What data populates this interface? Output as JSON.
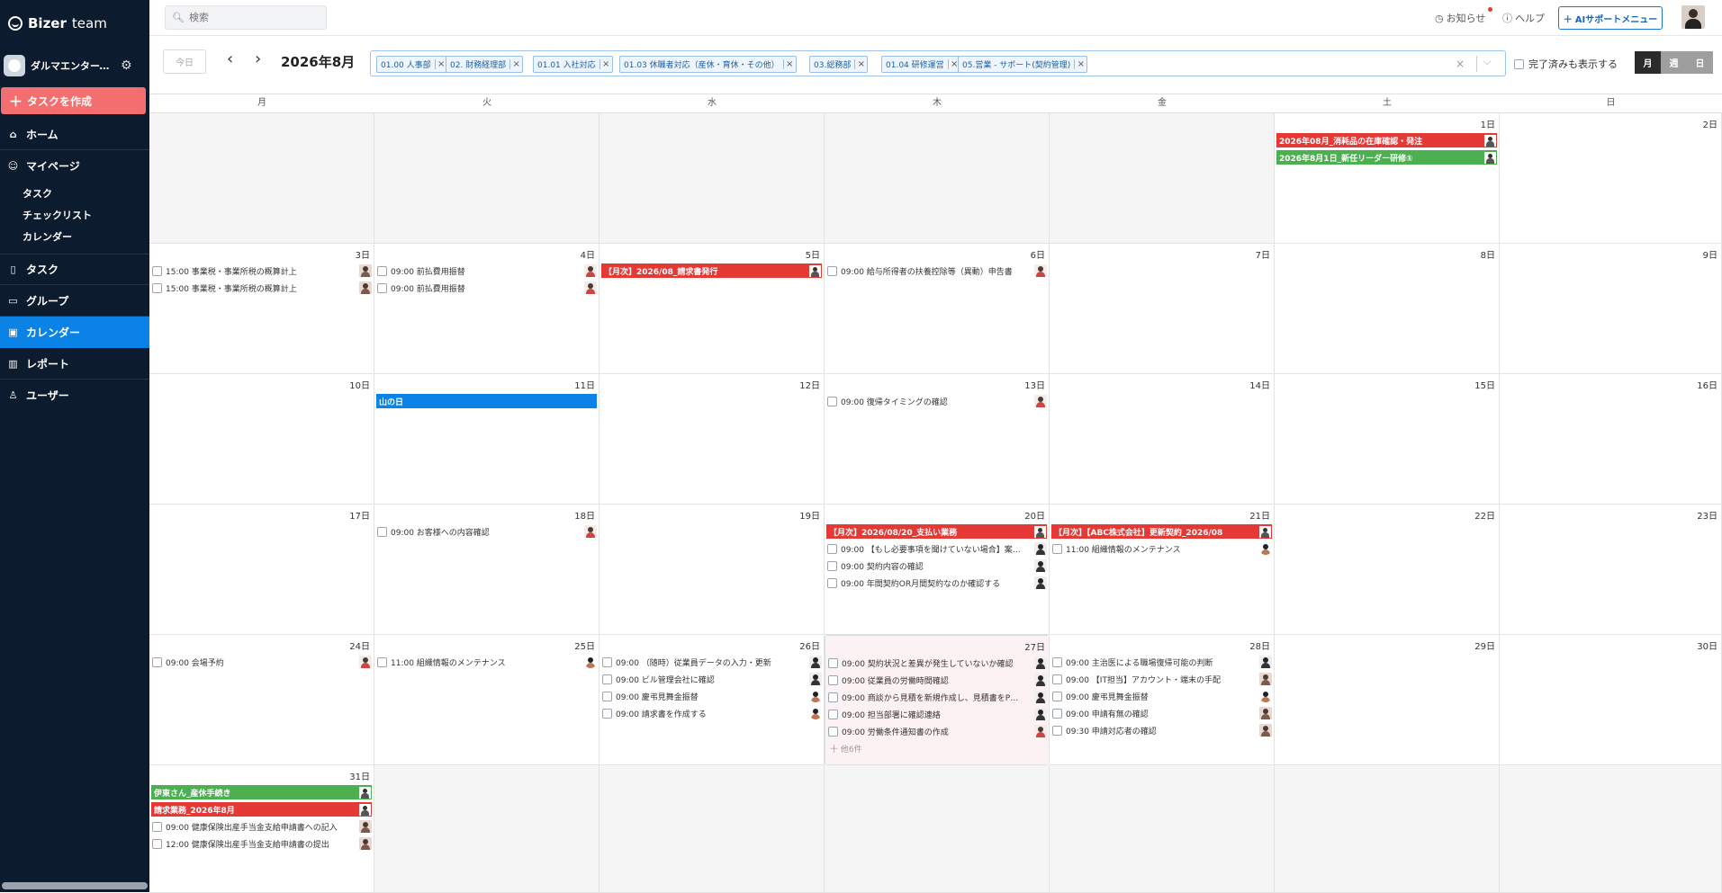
{
  "app": {
    "logo_brand": "Bizer",
    "logo_suffix": "team"
  },
  "sidebar": {
    "org_name": "ダルマエンタープ…",
    "create_task": "タスクを作成",
    "home": "ホーム",
    "mypage": "マイページ",
    "mypage_sub": [
      "タスク",
      "チェックリスト",
      "カレンダー"
    ],
    "tasks": "タスク",
    "groups": "グループ",
    "calendar": "カレンダー",
    "reports": "レポート",
    "users": "ユーザー"
  },
  "topbar": {
    "search_placeholder": "検索",
    "notices": "お知らせ",
    "help": "ヘルプ",
    "ai_menu": "AIサポートメニュー"
  },
  "toolbar": {
    "today": "今日",
    "month_label": "2026年8月",
    "show_done": "完了済みも表示する",
    "view_month": "月",
    "view_week": "週",
    "view_day": "日",
    "filters": [
      "01.00 人事部",
      "02. 財務経理部",
      "01.01 入社対応",
      "01.03 休職者対応（産休・育休・その他）",
      "03.総務部",
      "01.04 研修運営",
      "05.営業 - サポート(契約管理)"
    ]
  },
  "weekdays": [
    "月",
    "火",
    "水",
    "木",
    "金",
    "土",
    "日"
  ],
  "days": {
    "d1": "1日",
    "d2": "2日",
    "d3": "3日",
    "d4": "4日",
    "d5": "5日",
    "d6": "6日",
    "d7": "7日",
    "d8": "8日",
    "d9": "9日",
    "d10": "10日",
    "d11": "11日",
    "d12": "12日",
    "d13": "13日",
    "d14": "14日",
    "d15": "15日",
    "d16": "16日",
    "d17": "17日",
    "d18": "18日",
    "d19": "19日",
    "d20": "20日",
    "d21": "21日",
    "d22": "22日",
    "d23": "23日",
    "d24": "24日",
    "d25": "25日",
    "d26": "26日",
    "d27": "27日",
    "d28": "28日",
    "d29": "29日",
    "d30": "30日",
    "d31": "31日"
  },
  "events": {
    "e1a": "2026年08月_消耗品の在庫確認・発注",
    "e1b": "2026年8月1日_新任リーダー研修①",
    "e3a": "15:00 事業税・事業所税の概算計上",
    "e3b": "15:00 事業税・事業所税の概算計上",
    "e4a": "09:00 前払費用振替",
    "e4b": "09:00 前払費用振替",
    "e5a": "【月次】2026/08_請求書発行",
    "e6a": "09:00 給与所得者の扶養控除等（異動）申告書",
    "e11a": "山の日",
    "e13a": "09:00 復帰タイミングの確認",
    "e18a": "09:00 お客様への内容確認",
    "e20a": "【月次】2026/08/20_支払い業務",
    "e20b": "09:00 【もし必要事項を聞けていない場合】案…",
    "e20c": "09:00 契約内容の確認",
    "e20d": "09:00 年間契約OR月間契約なのか確認する",
    "e21a": "【月次】【ABC株式会社】更新契約_2026/08",
    "e21b": "11:00 組織情報のメンテナンス",
    "e24a": "09:00 会場予約",
    "e25a": "11:00 組織情報のメンテナンス",
    "e26a": "09:00 （随時）従業員データの入力・更新",
    "e26b": "09:00 ビル管理会社に確認",
    "e26c": "09:00 慶弔見舞金振替",
    "e26d": "09:00 請求書を作成する",
    "e27a": "09:00 契約状況と差異が発生していないか確認",
    "e27b": "09:00 従業員の労働時間確認",
    "e27c": "09:00 商談から見積を新規作成し、見積書をP…",
    "e27d": "09:00 担当部署に確認連絡",
    "e27e": "09:00 労働条件通知書の作成",
    "e27more": "十 他6件",
    "e28a": "09:00 主治医による職場復帰可能の判断",
    "e28b": "09:00 【IT担当】アカウント・端末の手配",
    "e28c": "09:00 慶弔見舞金振替",
    "e28d": "09:00 申請有無の確認",
    "e28e": "09:30 申請対応者の確認",
    "e31a": "伊東さん_産休手続き",
    "e31b": "請求業務_2026年8月",
    "e31c": "09:00 健康保険出産手当金支給申請書への記入",
    "e31d": "12:00 健康保険出産手当金支給申請書の提出"
  },
  "colors": {
    "red": "#e53935",
    "green": "#4caf50",
    "blue": "#0b83e6",
    "sidebar": "#0d1b2e",
    "create": "#f36e6e"
  }
}
